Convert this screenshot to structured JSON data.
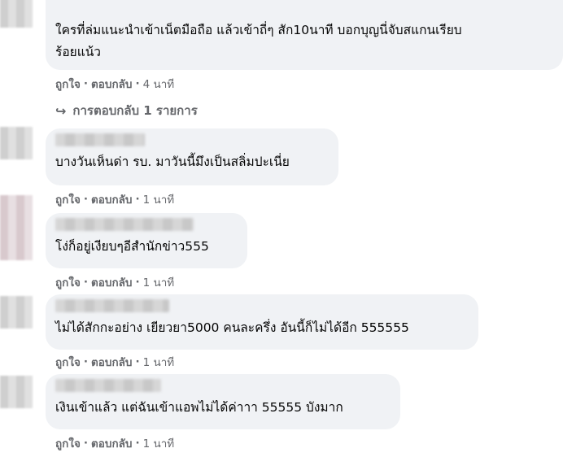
{
  "comments": [
    {
      "lines": [
        "ใครที่ล่มแนะนำเข้าเน็ตมือถือ แล้วเข้าถี่ๆ สัก10นาที บอกบุญนี่จับสแกนเรียบ",
        "ร้อยแน้ว"
      ],
      "like": "ถูกใจ",
      "reply": "ตอบกลับ",
      "time": "4 นาที"
    },
    {
      "lines": [
        "บางวันเห็นด่า รบ. มาวันนี้มึงเป็นสลิ่มปะเนี่ย"
      ],
      "like": "ถูกใจ",
      "reply": "ตอบกลับ",
      "time": "1 นาที"
    },
    {
      "lines": [
        "โง่ก็อยู่เงียบๆอีสำนักข่าว555"
      ],
      "like": "ถูกใจ",
      "reply": "ตอบกลับ",
      "time": "1 นาที"
    },
    {
      "lines": [
        "ไม่ได้สักกะอย่าง เยียวยา5000 คนละครึ่ง อันนี้ก็ไม่ได้อีก 555555"
      ],
      "like": "ถูกใจ",
      "reply": "ตอบกลับ",
      "time": "1 นาที"
    },
    {
      "lines": [
        "เงินเข้าแล้ว แต่ฉันเข้าแอพไม่ได้ค่าาา 55555 บังมาก"
      ],
      "like": "ถูกใจ",
      "reply": "ตอบกลับ",
      "time": "1 นาที"
    }
  ],
  "replies_link": "การตอบกลับ 1 รายการ",
  "separator": "·",
  "icons": {
    "reply_arrow": "reply-arrow-icon"
  }
}
